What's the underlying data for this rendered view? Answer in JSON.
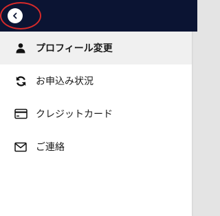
{
  "header": {
    "back_icon": "chevron-left-circle-icon",
    "bg_color": "#0b1433",
    "highlight_color": "#d62a2a"
  },
  "menu": {
    "items": [
      {
        "label": "プロフィール変更",
        "icon": "person-icon",
        "active": true
      },
      {
        "label": "お申込み状況",
        "icon": "refresh-icon",
        "active": false
      },
      {
        "label": "クレジットカード",
        "icon": "credit-card-icon",
        "active": false
      },
      {
        "label": "ご連絡",
        "icon": "envelope-icon",
        "active": false
      }
    ]
  }
}
